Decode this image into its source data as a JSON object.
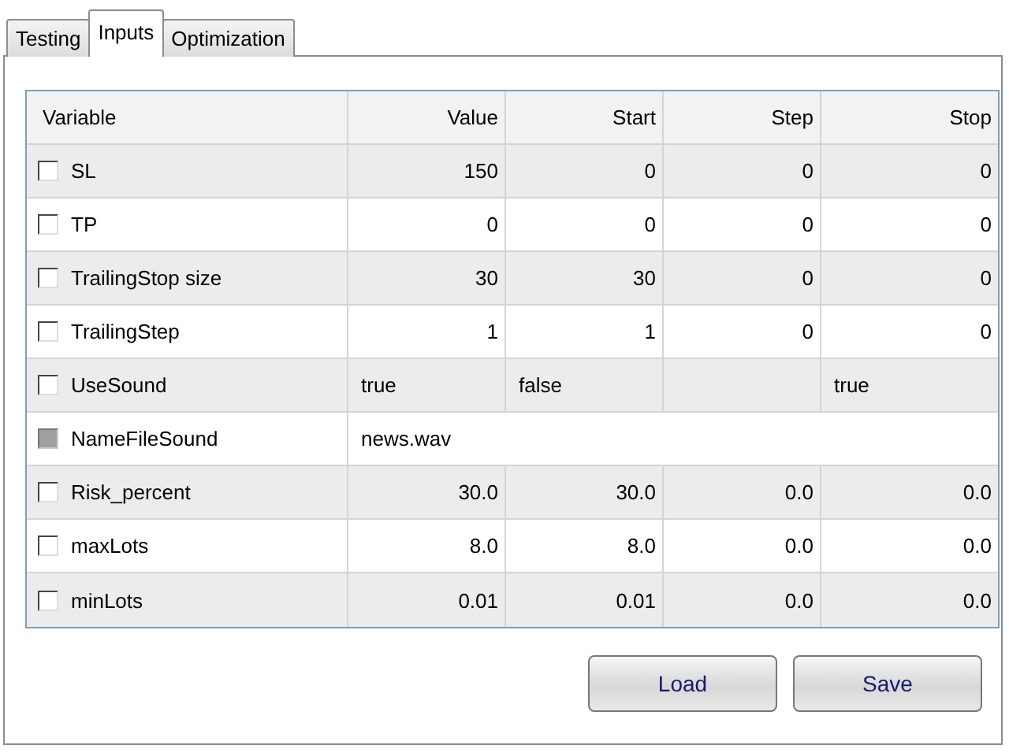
{
  "tabs": [
    {
      "label": "Testing",
      "selected": false
    },
    {
      "label": "Inputs",
      "selected": true
    },
    {
      "label": "Optimization",
      "selected": false
    }
  ],
  "table": {
    "columns": [
      "Variable",
      "Value",
      "Start",
      "Step",
      "Stop"
    ],
    "rows": [
      {
        "name": "SL",
        "kind": "number",
        "checked": false,
        "disabled": false,
        "value": "150",
        "start": "0",
        "step": "0",
        "stop": "0"
      },
      {
        "name": "TP",
        "kind": "number",
        "checked": false,
        "disabled": false,
        "value": "0",
        "start": "0",
        "step": "0",
        "stop": "0"
      },
      {
        "name": "TrailingStop size",
        "kind": "number",
        "checked": false,
        "disabled": false,
        "value": "30",
        "start": "30",
        "step": "0",
        "stop": "0"
      },
      {
        "name": "TrailingStep",
        "kind": "number",
        "checked": false,
        "disabled": false,
        "value": "1",
        "start": "1",
        "step": "0",
        "stop": "0"
      },
      {
        "name": "UseSound",
        "kind": "text",
        "checked": false,
        "disabled": false,
        "value": "true",
        "start": "false",
        "stop": "true"
      },
      {
        "name": "NameFileSound",
        "kind": "text",
        "checked": false,
        "disabled": true,
        "value": "news.wav"
      },
      {
        "name": "Risk_percent",
        "kind": "number",
        "checked": false,
        "disabled": false,
        "value": "30.0",
        "start": "30.0",
        "step": "0.0",
        "stop": "0.0"
      },
      {
        "name": "maxLots",
        "kind": "number",
        "checked": false,
        "disabled": false,
        "value": "8.0",
        "start": "8.0",
        "step": "0.0",
        "stop": "0.0"
      },
      {
        "name": "minLots",
        "kind": "number",
        "checked": false,
        "disabled": false,
        "value": "0.01",
        "start": "0.01",
        "step": "0.0",
        "stop": "0.0"
      }
    ]
  },
  "buttons": [
    "Load",
    "Save"
  ]
}
